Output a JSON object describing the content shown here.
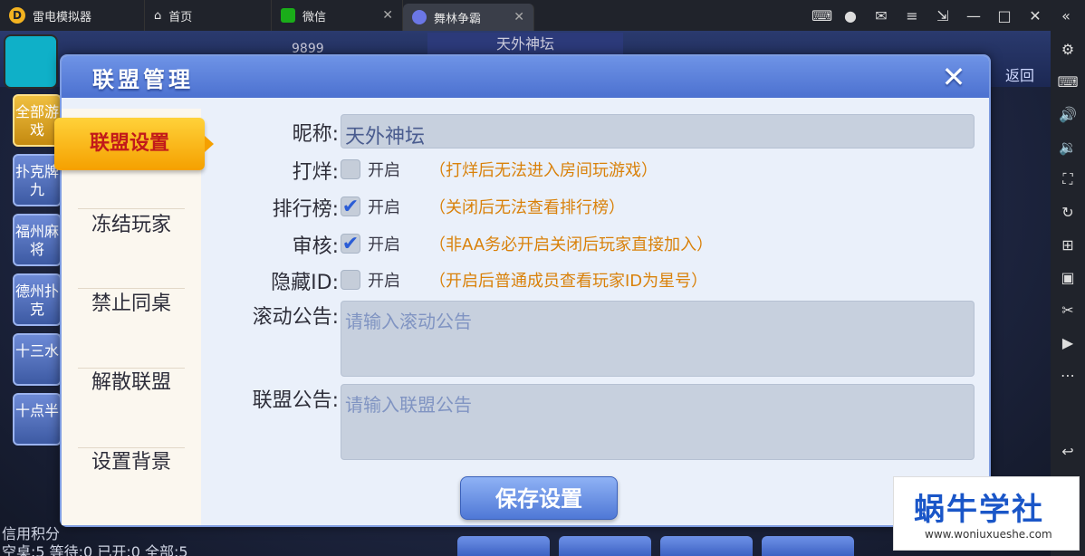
{
  "emulator": {
    "app_name": "雷电模拟器",
    "tabs": [
      {
        "label": "首页"
      },
      {
        "label": "微信"
      },
      {
        "label": "舞林争霸"
      }
    ]
  },
  "game": {
    "title_strip": "天外神坛",
    "left_list": [
      "全部游戏",
      "扑克牌九",
      "福州麻将",
      "德州扑克",
      "十三水",
      "十点半"
    ],
    "status_credit": "信用积分",
    "status_line": "空桌:5 等待:0 已开:0 全部:5",
    "top_counter": "9899",
    "back_label": "返回"
  },
  "modal": {
    "title": "联盟管理",
    "close": "✕",
    "menu": [
      {
        "label": "联盟设置",
        "active": true
      },
      {
        "label": "冻结玩家",
        "active": false
      },
      {
        "label": "禁止同桌",
        "active": false
      },
      {
        "label": "解散联盟",
        "active": false
      },
      {
        "label": "设置背景",
        "active": false
      }
    ],
    "form": {
      "nickname_label": "昵称:",
      "nickname_value": "天外神坛",
      "close_label": "打烊:",
      "close_checked": false,
      "close_text": "开启",
      "close_hint": "（打烊后无法进入房间玩游戏）",
      "rank_label": "排行榜:",
      "rank_checked": true,
      "rank_text": "开启",
      "rank_hint": "（关闭后无法查看排行榜）",
      "review_label": "审核:",
      "review_checked": true,
      "review_text": "开启",
      "review_hint": "（非AA务必开启关闭后玩家直接加入）",
      "hideid_label": "隐藏ID:",
      "hideid_checked": false,
      "hideid_text": "开启",
      "hideid_hint": "（开启后普通成员查看玩家ID为星号）",
      "scroll_notice_label": "滚动公告:",
      "scroll_notice_placeholder": "请输入滚动公告",
      "alliance_notice_label": "联盟公告:",
      "alliance_notice_placeholder": "请输入联盟公告"
    },
    "save_label": "保存设置"
  },
  "watermark": {
    "title": "蜗牛学社",
    "url": "www.woniuxueshe.com"
  }
}
